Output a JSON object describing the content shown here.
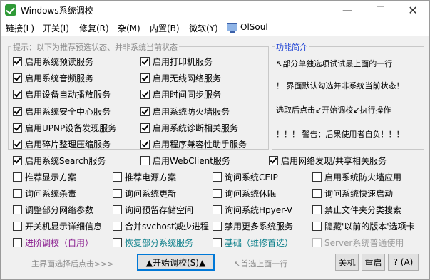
{
  "window": {
    "title": "Windows系统调校",
    "minimize_glyph": "—",
    "close_glyph": "✕"
  },
  "menu": {
    "items": [
      "链接(L)",
      "开关(I)",
      "修复(R)",
      "杂(M)",
      "内置(B)",
      "微软(Y)"
    ],
    "olsoul": "OlSoul"
  },
  "left_group": {
    "legend": "提示：以下为推荐预选状态、并非系统当前状态",
    "col1": [
      {
        "label": "启用系统预读服务",
        "checked": true
      },
      {
        "label": "启用系统音频服务",
        "checked": true
      },
      {
        "label": "启用设备自动播放服务",
        "checked": true
      },
      {
        "label": "启用系统安全中心服务",
        "checked": true
      },
      {
        "label": "启用UPNP设备发现服务",
        "checked": true
      },
      {
        "label": "启用碎片整理压缩服务",
        "checked": true
      },
      {
        "label": "启用系统Search服务",
        "checked": true
      }
    ],
    "col2": [
      {
        "label": "启用打印机服务",
        "checked": true
      },
      {
        "label": "启用无线网络服务",
        "checked": true
      },
      {
        "label": "启用时间同步服务",
        "checked": true
      },
      {
        "label": "启用系统防火墙服务",
        "checked": true
      },
      {
        "label": "启用系统诊断相关服务",
        "checked": true
      },
      {
        "label": "启用程序兼容性助手服务",
        "checked": true
      },
      {
        "label": "启用WebClient服务",
        "checked": false
      }
    ]
  },
  "network_option": {
    "label": "启用网络发现/共享相关服务",
    "checked": true
  },
  "info_group": {
    "legend": "功能简介",
    "lines": [
      "↖部分单独选项试试最上面的一行",
      "！ 界面默认勾选并非系统当前状态！",
      "选取后点击↙开始调校↙执行操作",
      "！！！ 警告：后果使用者自负！！！"
    ]
  },
  "grid_options": [
    [
      "推荐显示方案",
      "推荐电源方案",
      "询问系统CEIP",
      "启用系统防火墙应用"
    ],
    [
      "询问系统杀毒",
      "询问系统更新",
      "询问系统休眠",
      "询问系统快速启动"
    ],
    [
      "调整部分网络参数",
      "询问预留存储空间",
      "询问系统Hpyer-V",
      "禁止文件夹分类搜索"
    ],
    [
      "开关机显示详细信息",
      "合并svchost减少进程",
      "禁用更多系统服务",
      "隐藏'以前的版本'选项卡"
    ]
  ],
  "special_options": [
    {
      "label": "进阶调校（自用）",
      "style": "purple"
    },
    {
      "label": "恢复部分系统服务",
      "style": "teal"
    },
    {
      "label": "基础（维修首选）",
      "style": "teal"
    },
    {
      "label": "Server系统普通使用",
      "style": "disabled"
    }
  ],
  "bottom": {
    "hint_left": "主界面选择后点击>>>",
    "start_button": "▲开始调校(S)▲",
    "hint_right": "↖首选上面一行",
    "shutdown_button": "关机",
    "restart_button": "重启",
    "help_button": "? (A)"
  },
  "colors": {
    "accent_blue": "#1a3fd4",
    "purple": "#8a1d8f",
    "teal": "#0b7f8a",
    "app_icon_green": "#2f9a37"
  }
}
